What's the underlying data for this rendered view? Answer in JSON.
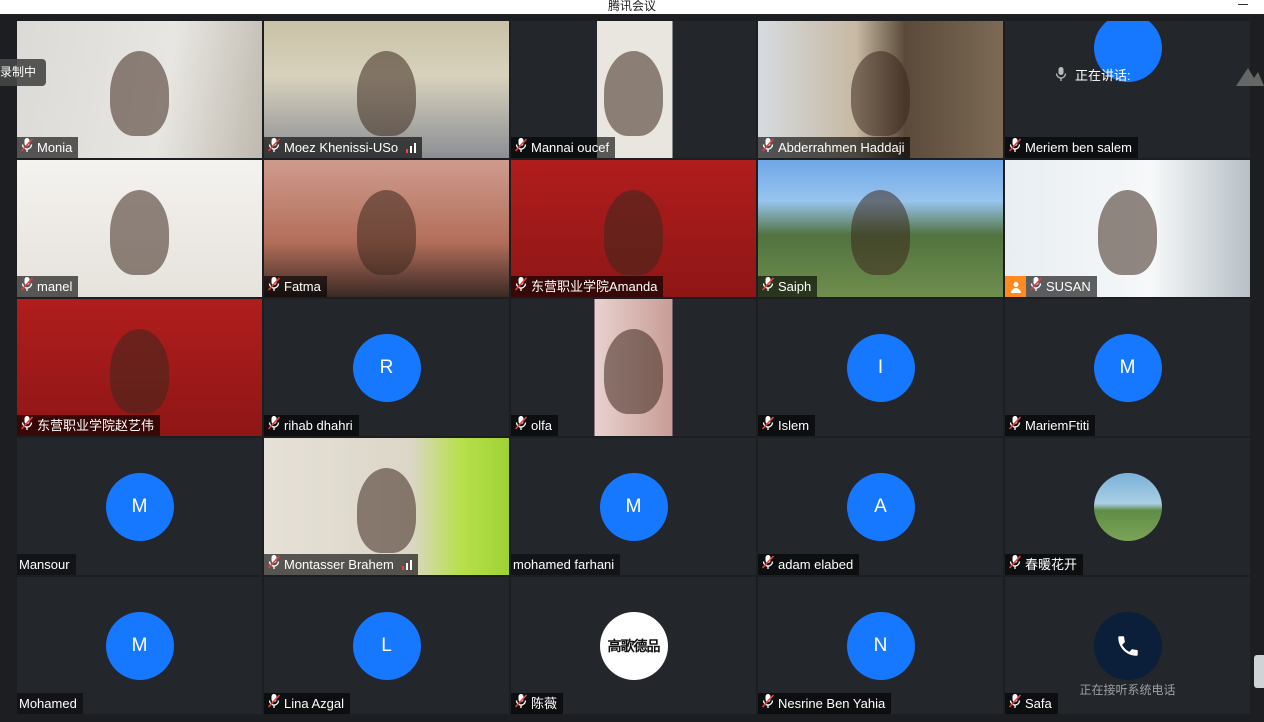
{
  "window": {
    "title": "腾讯会议"
  },
  "recording_label": "录制中",
  "speaking_label": "正在讲话:",
  "participants": [
    {
      "name": "Monia",
      "type": "video",
      "bg": "office",
      "signal": false
    },
    {
      "name": "Moez Khenissi-USo",
      "type": "video",
      "bg": "ceiling",
      "signal": true
    },
    {
      "name": "Mannai oucef",
      "type": "video",
      "bg": "dark",
      "signal": false
    },
    {
      "name": "Abderrahmen Haddaji",
      "type": "video",
      "bg": "shelf",
      "signal": false
    },
    {
      "name": "Meriem ben salem",
      "type": "avatar",
      "initial": "",
      "signal": false
    },
    {
      "name": "manel",
      "type": "video",
      "bg": "white",
      "signal": false
    },
    {
      "name": "Fatma",
      "type": "video",
      "bg": "warm",
      "signal": false
    },
    {
      "name": "东营职业学院Amanda",
      "type": "video",
      "bg": "red",
      "signal": false
    },
    {
      "name": "Saiph",
      "type": "video",
      "bg": "mount",
      "signal": false
    },
    {
      "name": "SUSAN",
      "type": "video",
      "bg": "sign",
      "signal": false,
      "host": true
    },
    {
      "name": "东营职业学院赵艺伟",
      "type": "video",
      "bg": "red",
      "signal": false
    },
    {
      "name": "rihab dhahri",
      "type": "avatar",
      "initial": "R"
    },
    {
      "name": "olfa",
      "type": "video",
      "bg": "pink"
    },
    {
      "name": "Islem",
      "type": "avatar",
      "initial": "I"
    },
    {
      "name": "MariemFtiti",
      "type": "avatar",
      "initial": "M"
    },
    {
      "name": "Mansour",
      "type": "avatar",
      "initial": "M",
      "no_mic": true
    },
    {
      "name": "Montasser Brahem",
      "type": "video",
      "bg": "green",
      "signal": true
    },
    {
      "name": "mohamed farhani",
      "type": "avatar",
      "initial": "M",
      "no_mic": true
    },
    {
      "name": "adam elabed",
      "type": "avatar",
      "initial": "A"
    },
    {
      "name": "春暖花开",
      "type": "image_avatar"
    },
    {
      "name": "Mohamed",
      "type": "avatar",
      "initial": "M",
      "no_mic": true
    },
    {
      "name": "Lina Azgal",
      "type": "avatar",
      "initial": "L"
    },
    {
      "name": "陈薇",
      "type": "logo_avatar",
      "logo_text": "高歌德品"
    },
    {
      "name": "Nesrine Ben Yahia",
      "type": "avatar",
      "initial": "N"
    },
    {
      "name": "Safa",
      "type": "call_avatar",
      "caption": "正在接听系统电话"
    }
  ],
  "colors": {
    "avatar_blue": "#1677ff",
    "host_orange": "#ff8a1f",
    "mic_muted_red": "#e04040"
  }
}
